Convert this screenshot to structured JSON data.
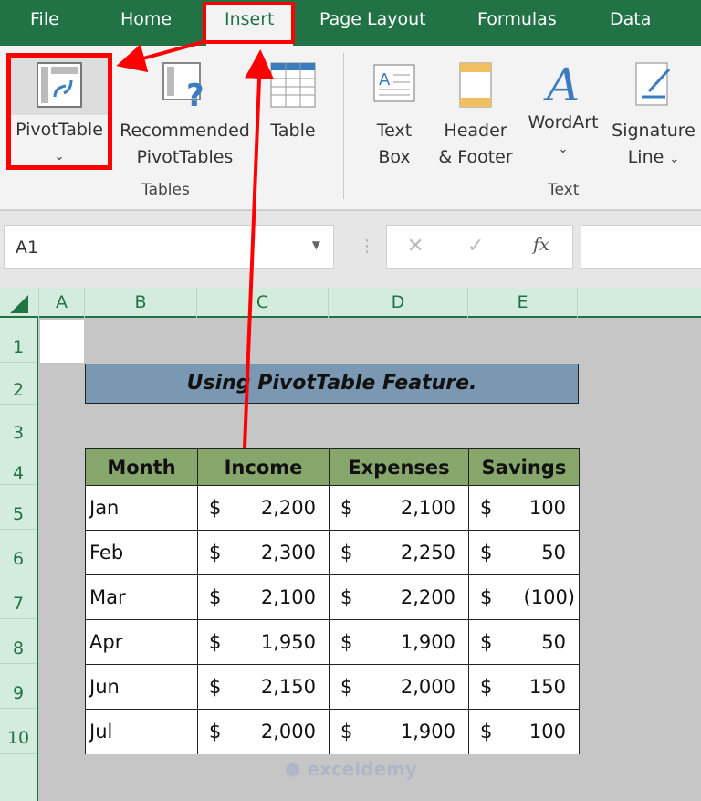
{
  "tabs": [
    "File",
    "Home",
    "Insert",
    "Page Layout",
    "Formulas",
    "Data"
  ],
  "ribbon": {
    "pivottable": "PivotTable",
    "recommended_1": "Recommended",
    "recommended_2": "PivotTables",
    "table": "Table",
    "textbox_1": "Text",
    "textbox_2": "Box",
    "header_1": "Header",
    "header_2": "& Footer",
    "wordart": "WordArt",
    "signature_1": "Signature",
    "signature_2": "Line",
    "group_tables": "Tables",
    "group_text": "Text",
    "dropdown_glyph": "⌄"
  },
  "formula_bar": {
    "name_box": "A1",
    "cancel": "✕",
    "enter": "✓",
    "fx": "fx",
    "formula": ""
  },
  "columns": [
    "A",
    "B",
    "C",
    "D",
    "E"
  ],
  "rows": [
    "1",
    "2",
    "3",
    "4",
    "5",
    "6",
    "7",
    "8",
    "9",
    "10"
  ],
  "sheet": {
    "title": "Using PivotTable Feature.",
    "headers": [
      "Month",
      "Income",
      "Expenses",
      "Savings"
    ],
    "currency": "$",
    "data": [
      [
        "Jan",
        "2,200",
        "2,100",
        "100"
      ],
      [
        "Feb",
        "2,300",
        "2,250",
        "50"
      ],
      [
        "Mar",
        "2,100",
        "2,200",
        "(100)"
      ],
      [
        "Apr",
        "1,950",
        "1,900",
        "50"
      ],
      [
        "Jun",
        "2,150",
        "2,000",
        "150"
      ],
      [
        "Jul",
        "2,000",
        "1,900",
        "100"
      ]
    ]
  },
  "colors": {
    "excel_green": "#217346",
    "highlight": "#ff0000",
    "title_fill": "#7a98b2",
    "header_fill": "#86a66b"
  },
  "watermark": "exceldemy"
}
